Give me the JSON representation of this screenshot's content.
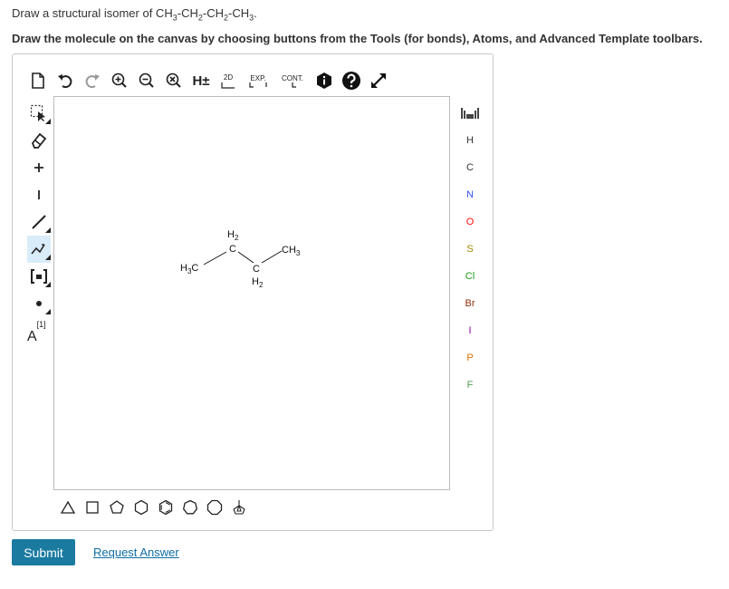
{
  "question": {
    "prefix": "Draw a structural isomer of CH",
    "parts": [
      "3",
      "-CH",
      "2",
      "-CH",
      "2",
      "-CH",
      "3",
      "."
    ]
  },
  "instruction": "Draw the molecule on the canvas by choosing buttons from the Tools (for bonds), Atoms, and Advanced Template toolbars.",
  "top_toolbar": {
    "hydrogen_label": "H±",
    "label_2d": "2D",
    "expand_label": "EXP.",
    "contract_label": "CONT."
  },
  "left_toolbar": {
    "charge_label": "A",
    "charge_sup": "[1]"
  },
  "atoms": [
    "H",
    "C",
    "N",
    "O",
    "S",
    "Cl",
    "Br",
    "I",
    "P",
    "F"
  ],
  "molecule": {
    "label_h3c": "H",
    "label_h3c_sub": "3",
    "label_h3c_c": "C",
    "label_ch2_top": "H",
    "label_ch2_top_sub": "2",
    "label_c_top": "C",
    "label_c_bottom": "C",
    "label_ch2_bottom": "H",
    "label_ch2_bottom_sub": "2",
    "label_ch3": "CH",
    "label_ch3_sub": "3"
  },
  "buttons": {
    "submit": "Submit",
    "request_answer": "Request Answer"
  }
}
